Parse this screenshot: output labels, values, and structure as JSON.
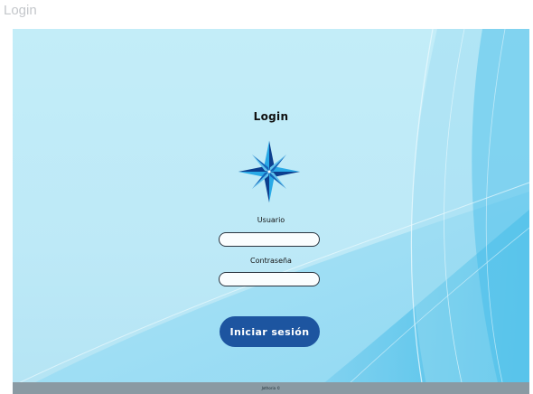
{
  "window": {
    "title": "Login"
  },
  "login": {
    "heading": "Login",
    "logo": "compass-rose-icon",
    "username_label": "Usuario",
    "username_value": "",
    "password_label": "Contraseña",
    "password_value": "",
    "submit_label": "Iniciar sesión"
  },
  "footer": {
    "text": "Jothoria ©"
  },
  "colors": {
    "background": "#c3edf8",
    "wave_dark": "#2ab4e6",
    "button": "#1d55a0",
    "logo_dark": "#0d3f8e",
    "logo_light": "#29a9e6",
    "footer": "#8a9aa3"
  }
}
